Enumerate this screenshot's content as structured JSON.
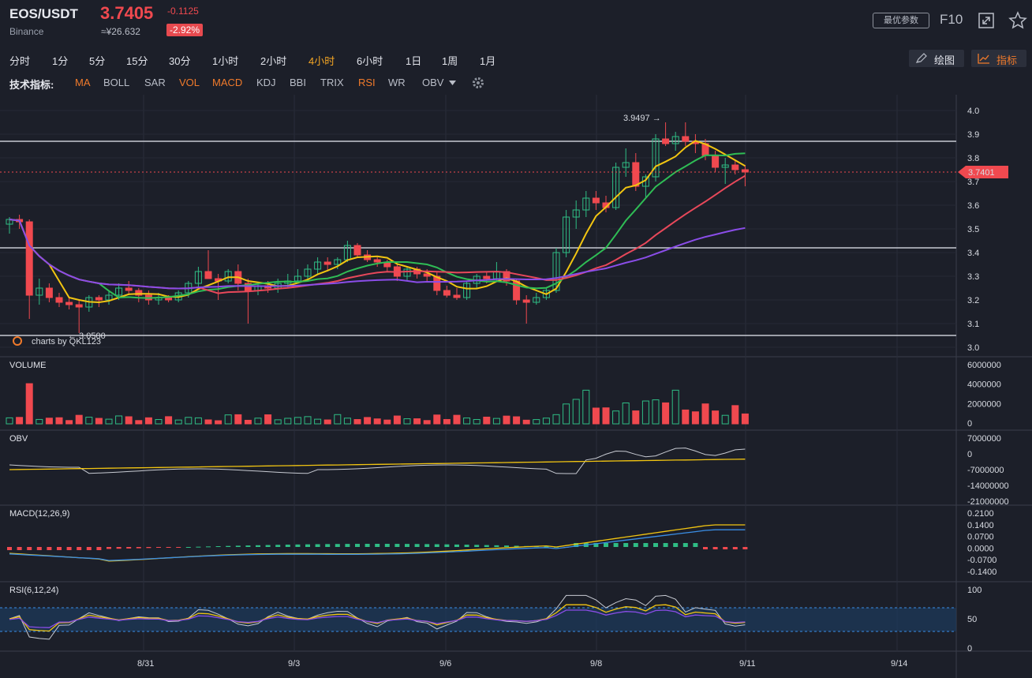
{
  "header": {
    "pair": "EOS/USDT",
    "exchange": "Binance",
    "price": "3.7405",
    "change": "-0.1125",
    "cny": "≈¥26.632",
    "change_pct": "-2.92%",
    "best_params": "最优参数",
    "f10": "F10"
  },
  "timeframes": [
    "分时",
    "1分",
    "5分",
    "15分",
    "30分",
    "1小时",
    "2小时",
    "4小时",
    "6小时",
    "1日",
    "1周",
    "1月"
  ],
  "active_timeframe": "4小时",
  "toolbar": {
    "draw_label": "绘图",
    "indicator_label": "指标"
  },
  "indicators": {
    "label": "技术指标:",
    "items": [
      {
        "name": "MA",
        "on": true
      },
      {
        "name": "BOLL",
        "on": false
      },
      {
        "name": "SAR",
        "on": false
      },
      {
        "name": "VOL",
        "on": true
      },
      {
        "name": "MACD",
        "on": true
      },
      {
        "name": "KDJ",
        "on": false
      },
      {
        "name": "BBI",
        "on": false
      },
      {
        "name": "TRIX",
        "on": false
      },
      {
        "name": "RSI",
        "on": true
      },
      {
        "name": "WR",
        "on": false
      },
      {
        "name": "OBV",
        "on": false
      }
    ]
  },
  "colors": {
    "up": "#2fbd85",
    "down": "#f0494f",
    "accent": "#f5a623",
    "ma_yellow": "#f2c511",
    "ma_green": "#2fbd55",
    "ma_red": "#e8485a",
    "ma_purple": "#8a4de8"
  },
  "chart_data": [
    {
      "type": "candlestick",
      "title": "EOS/USDT 4小时",
      "price_axis": [
        "4.0",
        "3.9",
        "3.8",
        "3.7",
        "3.6",
        "3.5",
        "3.4",
        "3.3",
        "3.2",
        "3.1",
        "3.0"
      ],
      "ylim": [
        3.0,
        4.0
      ],
      "date_ticks": [
        "8/31",
        "9/3",
        "9/6",
        "9/8",
        "9/11",
        "9/14"
      ],
      "current_price_tag": "3.7401",
      "max_annotation": "3.9497 →",
      "min_annotation": "← 3.0500",
      "horizontal_lines": [
        3.87,
        3.42,
        3.05
      ],
      "watermark": "charts by QKL123",
      "candles": [
        [
          3.52,
          3.55,
          3.48,
          3.54
        ],
        [
          3.54,
          3.56,
          3.5,
          3.53
        ],
        [
          3.53,
          3.54,
          3.12,
          3.22
        ],
        [
          3.22,
          3.29,
          3.18,
          3.25
        ],
        [
          3.25,
          3.27,
          3.19,
          3.21
        ],
        [
          3.21,
          3.23,
          3.17,
          3.19
        ],
        [
          3.19,
          3.21,
          3.16,
          3.18
        ],
        [
          3.18,
          3.2,
          3.06,
          3.17
        ],
        [
          3.17,
          3.22,
          3.15,
          3.21
        ],
        [
          3.21,
          3.22,
          3.17,
          3.2
        ],
        [
          3.2,
          3.24,
          3.18,
          3.22
        ],
        [
          3.22,
          3.27,
          3.2,
          3.25
        ],
        [
          3.25,
          3.28,
          3.22,
          3.24
        ],
        [
          3.24,
          3.25,
          3.19,
          3.22
        ],
        [
          3.22,
          3.24,
          3.18,
          3.2
        ],
        [
          3.2,
          3.23,
          3.18,
          3.21
        ],
        [
          3.21,
          3.22,
          3.19,
          3.2
        ],
        [
          3.2,
          3.24,
          3.19,
          3.23
        ],
        [
          3.23,
          3.28,
          3.21,
          3.27
        ],
        [
          3.27,
          3.34,
          3.25,
          3.32
        ],
        [
          3.32,
          3.41,
          3.3,
          3.29
        ],
        [
          3.29,
          3.31,
          3.2,
          3.28
        ],
        [
          3.28,
          3.33,
          3.27,
          3.32
        ],
        [
          3.32,
          3.35,
          3.24,
          3.27
        ],
        [
          3.27,
          3.29,
          3.1,
          3.24
        ],
        [
          3.24,
          3.27,
          3.22,
          3.26
        ],
        [
          3.26,
          3.28,
          3.23,
          3.25
        ],
        [
          3.25,
          3.29,
          3.23,
          3.27
        ],
        [
          3.27,
          3.31,
          3.25,
          3.28
        ],
        [
          3.28,
          3.33,
          3.27,
          3.3
        ],
        [
          3.3,
          3.35,
          3.28,
          3.33
        ],
        [
          3.33,
          3.38,
          3.31,
          3.36
        ],
        [
          3.36,
          3.38,
          3.32,
          3.35
        ],
        [
          3.35,
          3.38,
          3.33,
          3.37
        ],
        [
          3.37,
          3.45,
          3.36,
          3.43
        ],
        [
          3.43,
          3.44,
          3.38,
          3.39
        ],
        [
          3.39,
          3.41,
          3.36,
          3.37
        ],
        [
          3.37,
          3.38,
          3.34,
          3.36
        ],
        [
          3.36,
          3.37,
          3.32,
          3.34
        ],
        [
          3.34,
          3.35,
          3.28,
          3.3
        ],
        [
          3.3,
          3.34,
          3.28,
          3.33
        ],
        [
          3.33,
          3.34,
          3.29,
          3.31
        ],
        [
          3.31,
          3.33,
          3.28,
          3.3
        ],
        [
          3.3,
          3.32,
          3.22,
          3.24
        ],
        [
          3.24,
          3.26,
          3.21,
          3.22
        ],
        [
          3.22,
          3.25,
          3.2,
          3.21
        ],
        [
          3.21,
          3.28,
          3.2,
          3.27
        ],
        [
          3.27,
          3.31,
          3.25,
          3.3
        ],
        [
          3.3,
          3.32,
          3.27,
          3.29
        ],
        [
          3.29,
          3.36,
          3.28,
          3.32
        ],
        [
          3.32,
          3.33,
          3.26,
          3.28
        ],
        [
          3.28,
          3.29,
          3.18,
          3.2
        ],
        [
          3.2,
          3.22,
          3.1,
          3.19
        ],
        [
          3.19,
          3.23,
          3.18,
          3.21
        ],
        [
          3.21,
          3.25,
          3.2,
          3.24
        ],
        [
          3.24,
          3.42,
          3.23,
          3.4
        ],
        [
          3.4,
          3.58,
          3.38,
          3.55
        ],
        [
          3.55,
          3.62,
          3.5,
          3.58
        ],
        [
          3.58,
          3.66,
          3.55,
          3.63
        ],
        [
          3.63,
          3.66,
          3.58,
          3.61
        ],
        [
          3.61,
          3.64,
          3.57,
          3.59
        ],
        [
          3.59,
          3.78,
          3.58,
          3.76
        ],
        [
          3.76,
          3.84,
          3.72,
          3.78
        ],
        [
          3.78,
          3.82,
          3.66,
          3.68
        ],
        [
          3.68,
          3.73,
          3.63,
          3.72
        ],
        [
          3.72,
          3.9,
          3.7,
          3.88
        ],
        [
          3.88,
          3.95,
          3.85,
          3.86
        ],
        [
          3.86,
          3.91,
          3.83,
          3.89
        ],
        [
          3.89,
          3.95,
          3.85,
          3.87
        ],
        [
          3.87,
          3.9,
          3.82,
          3.86
        ],
        [
          3.86,
          3.88,
          3.79,
          3.81
        ],
        [
          3.81,
          3.83,
          3.74,
          3.76
        ],
        [
          3.76,
          3.8,
          3.69,
          3.77
        ],
        [
          3.77,
          3.79,
          3.73,
          3.75
        ],
        [
          3.75,
          3.77,
          3.68,
          3.74
        ]
      ]
    },
    {
      "type": "bar",
      "title": "VOLUME",
      "axis": [
        "6000000",
        "4000000",
        "2000000",
        "0"
      ],
      "ylim": [
        0,
        6500000
      ]
    },
    {
      "type": "line",
      "title": "OBV",
      "axis": [
        "7000000",
        "0",
        "-7000000",
        "-14000000",
        "-21000000"
      ]
    },
    {
      "type": "bar",
      "title": "MACD(12,26,9)",
      "axis": [
        "0.2100",
        "0.1400",
        "0.0700",
        "0.0000",
        "-0.0700",
        "-0.1400"
      ]
    },
    {
      "type": "line",
      "title": "RSI(6,12,24)",
      "axis": [
        "100",
        "50",
        "0"
      ]
    }
  ]
}
